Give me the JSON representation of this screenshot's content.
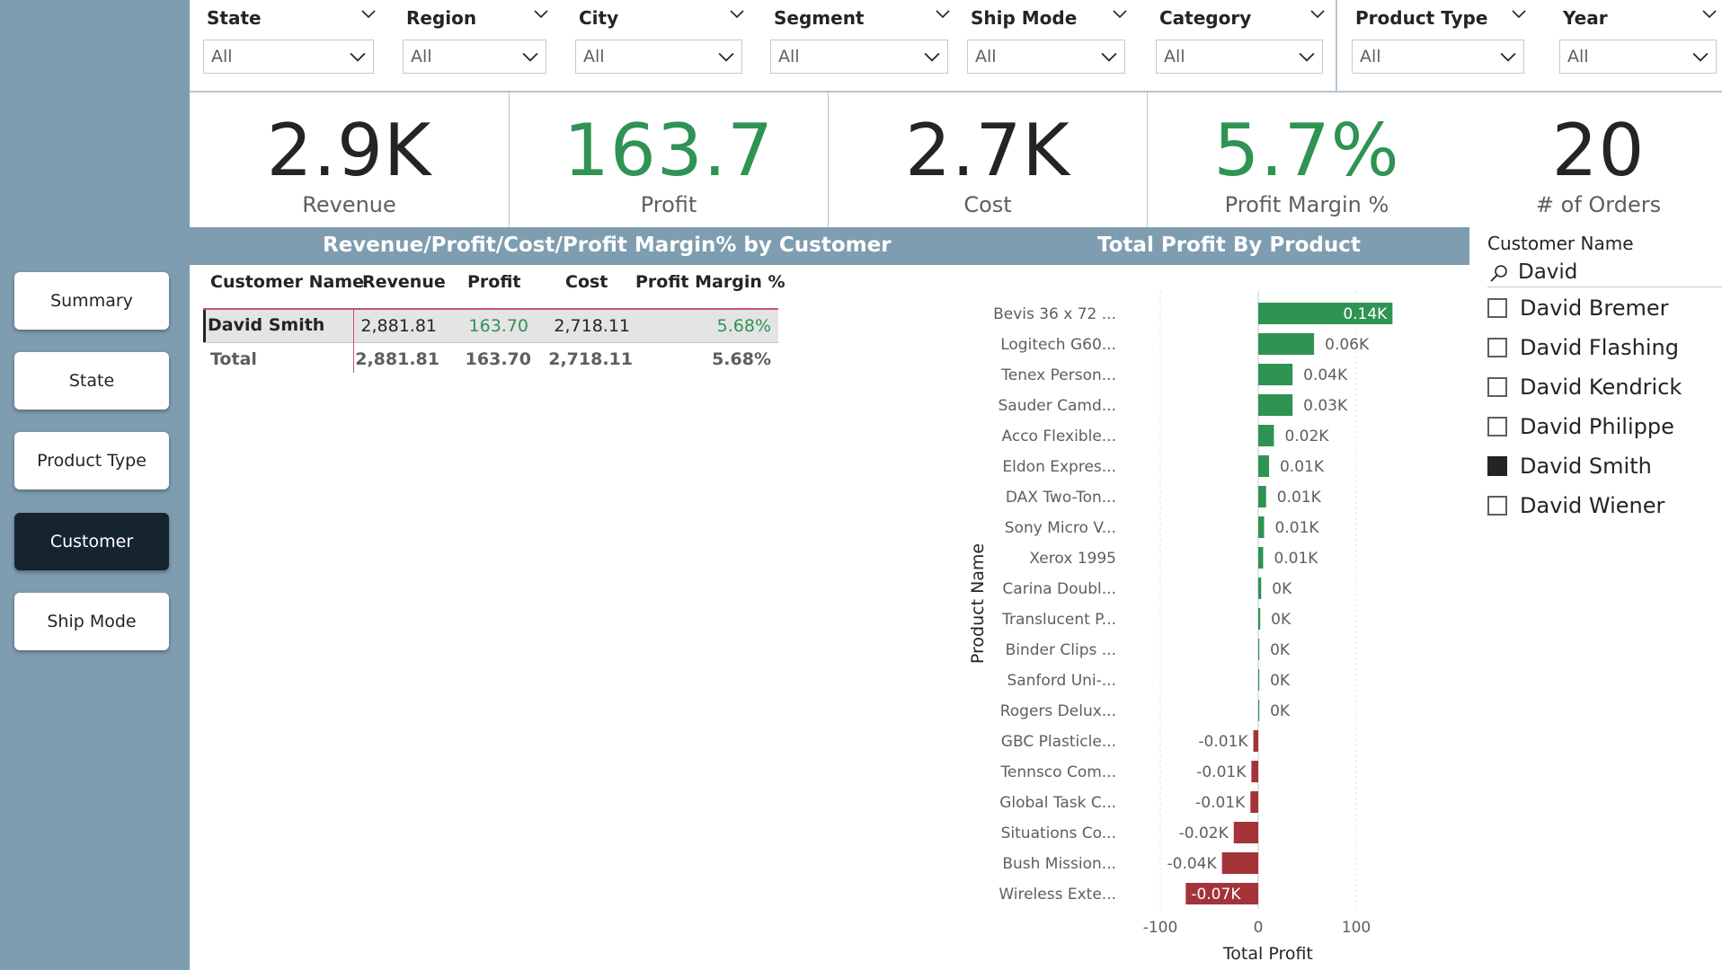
{
  "nav": {
    "items": [
      {
        "label": "Summary",
        "active": false
      },
      {
        "label": "State",
        "active": false
      },
      {
        "label": "Product Type",
        "active": false
      },
      {
        "label": "Customer",
        "active": true
      },
      {
        "label": "Ship Mode",
        "active": false
      }
    ]
  },
  "filters": [
    {
      "title": "State",
      "value": "All"
    },
    {
      "title": "Region",
      "value": "All"
    },
    {
      "title": "City",
      "value": "All"
    },
    {
      "title": "Segment",
      "value": "All"
    },
    {
      "title": "Ship Mode",
      "value": "All"
    },
    {
      "title": "Category",
      "value": "All"
    },
    {
      "title": "Product Type",
      "value": "All"
    },
    {
      "title": "Year",
      "value": "All"
    }
  ],
  "kpis": [
    {
      "value": "2.9K",
      "label": "Revenue",
      "color": "#252423"
    },
    {
      "value": "163.7",
      "label": "Profit",
      "color": "#2e9353"
    },
    {
      "value": "2.7K",
      "label": "Cost",
      "color": "#252423"
    },
    {
      "value": "5.7%",
      "label": "Profit Margin %",
      "color": "#2e9353"
    },
    {
      "value": "20",
      "label": "# of Orders",
      "color": "#252423"
    }
  ],
  "table_section": {
    "title": "Revenue/Profit/Cost/Profit Margin% by Customer",
    "columns": [
      "Customer Name",
      "Revenue",
      "Profit",
      "Cost",
      "Profit Margin %"
    ],
    "rows": [
      {
        "customer": "David Smith",
        "revenue": "2,881.81",
        "profit": "163.70",
        "cost": "2,718.11",
        "margin": "5.68%"
      }
    ],
    "total": {
      "label": "Total",
      "revenue": "2,881.81",
      "profit": "163.70",
      "cost": "2,718.11",
      "margin": "5.68%"
    }
  },
  "chart_section": {
    "title": "Total Profit By Product"
  },
  "chart_data": {
    "type": "bar",
    "orientation": "horizontal",
    "title": "Total Profit By Product",
    "xlabel": "Total Profit",
    "ylabel": "Product Name",
    "xlim": [
      -110,
      140
    ],
    "xticks": [
      -100,
      0,
      100
    ],
    "tick_labels": [
      "-100",
      "0",
      "100"
    ],
    "categories": [
      "Bevis 36 x 72 ...",
      "Logitech G60...",
      "Tenex Person...",
      "Sauder Camd...",
      "Acco Flexible...",
      "Eldon Expres...",
      "DAX Two-Ton...",
      "Sony Micro V...",
      "Xerox 1995",
      "Carina Doubl...",
      "Translucent P...",
      "Binder Clips ...",
      "Sanford Uni-...",
      "Rogers Delux...",
      "GBC Plasticle...",
      "Tennsco Com...",
      "Global Task C...",
      "Situations Co...",
      "Bush Mission...",
      "Wireless Exte..."
    ],
    "values": [
      137,
      57,
      35,
      35,
      16,
      11,
      8,
      6,
      5,
      3,
      2,
      1,
      1,
      1,
      -5,
      -7,
      -8,
      -25,
      -37,
      -74
    ],
    "data_labels": [
      "0.14K",
      "0.06K",
      "0.04K",
      "0.03K",
      "0.02K",
      "0.01K",
      "0.01K",
      "0.01K",
      "0.01K",
      "0K",
      "0K",
      "0K",
      "0K",
      "0K",
      "-0.01K",
      "-0.01K",
      "-0.01K",
      "-0.02K",
      "-0.04K",
      "-0.07K"
    ],
    "colors": {
      "positive": "#2e9353",
      "negative": "#a4343a"
    },
    "grid": true
  },
  "slicer": {
    "title": "Customer Name",
    "search": "David",
    "items": [
      {
        "label": "David Bremer",
        "checked": false
      },
      {
        "label": "David Flashing",
        "checked": false
      },
      {
        "label": "David Kendrick",
        "checked": false
      },
      {
        "label": "David Philippe",
        "checked": false
      },
      {
        "label": "David Smith",
        "checked": true
      },
      {
        "label": "David Wiener",
        "checked": false
      }
    ]
  }
}
